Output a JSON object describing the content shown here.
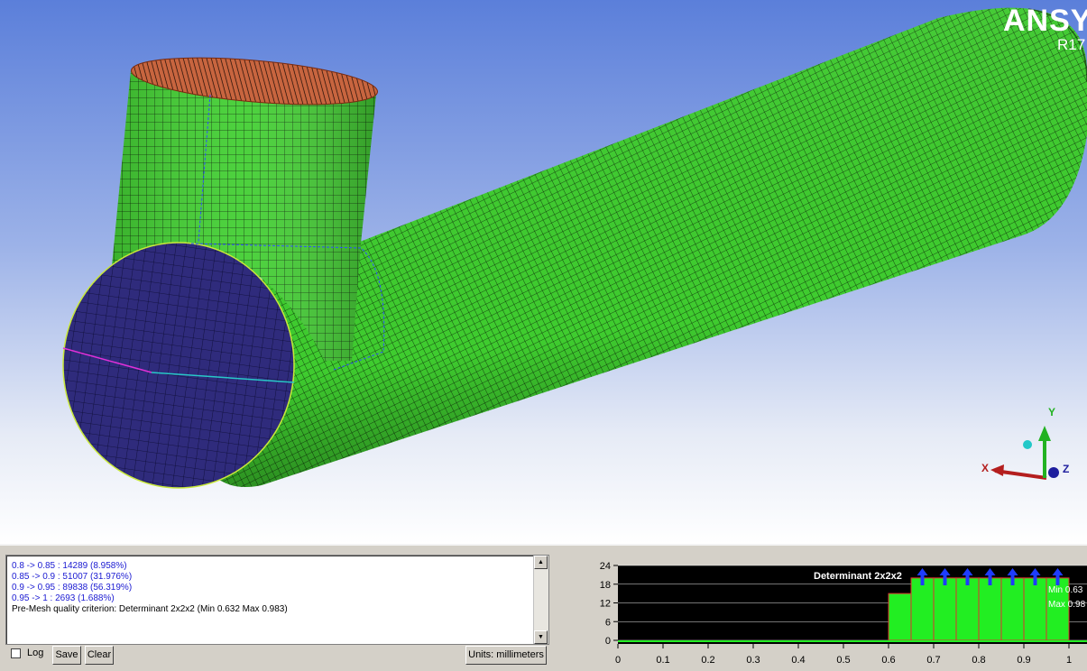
{
  "brand": {
    "name": "ANSYS",
    "version": "R17"
  },
  "triad": {
    "x_label": "X",
    "y_label": "Y",
    "z_label": "Z",
    "x_color": "#b41e1e",
    "y_color": "#22b222",
    "z_color": "#1e1e9e"
  },
  "colors": {
    "mesh_green": "#3ecb2e",
    "cap_blue": "#2d2a78",
    "top_cap": "#b4583a",
    "histogram_bar": "#22ee22"
  },
  "messages": {
    "lines": [
      "0.8 -> 0.85 : 14289 (8.958%)",
      "0.85 -> 0.9 : 51007 (31.976%)",
      "0.9 -> 0.95 : 89838 (56.319%)",
      "0.95 -> 1 : 2693 (1.688%)",
      "Pre-Mesh quality criterion: Determinant 2x2x2 (Min 0.632 Max 0.983)"
    ],
    "scroll_up_icon": "triangle-up",
    "scroll_down_icon": "triangle-down"
  },
  "controls": {
    "log_label": "Log",
    "log_checked": false,
    "save_label": "Save",
    "clear_label": "Clear",
    "units_label": "Units: millimeters"
  },
  "chart_data": {
    "type": "bar",
    "title": "Determinant 2x2x2",
    "min_label": "Min 0.63",
    "max_label": "Max 0.98",
    "xlim": [
      0,
      1
    ],
    "ylim": [
      0,
      24
    ],
    "x_ticks": [
      "0",
      "0.1",
      "0.2",
      "0.3",
      "0.4",
      "0.5",
      "0.6",
      "0.7",
      "0.8",
      "0.9",
      "1"
    ],
    "y_ticks": [
      "24",
      "18",
      "12",
      "6",
      "0"
    ],
    "bin_width": 0.05,
    "bins": [
      {
        "x": 0.6,
        "value": 15
      },
      {
        "x": 0.65,
        "value": 20
      },
      {
        "x": 0.7,
        "value": 20
      },
      {
        "x": 0.75,
        "value": 20
      },
      {
        "x": 0.8,
        "value": 20
      },
      {
        "x": 0.85,
        "value": 20
      },
      {
        "x": 0.9,
        "value": 20
      },
      {
        "x": 0.95,
        "value": 20
      }
    ],
    "selected_bins": [
      0.65,
      0.7,
      0.75,
      0.8,
      0.85,
      0.9,
      0.95
    ],
    "grid": true
  }
}
